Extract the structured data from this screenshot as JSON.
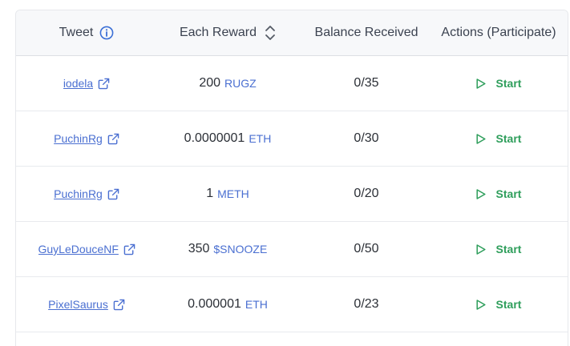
{
  "table": {
    "headers": {
      "tweet": "Tweet",
      "reward": "Each Reward",
      "balance": "Balance Received",
      "actions": "Actions (Participate)"
    },
    "rows": [
      {
        "tweet": "iodela",
        "amount": "200",
        "token": "RUGZ",
        "balance": "0/35",
        "action": "Start"
      },
      {
        "tweet": "PuchinRg",
        "amount": "0.0000001",
        "token": "ETH",
        "balance": "0/30",
        "action": "Start"
      },
      {
        "tweet": "PuchinRg",
        "amount": "1",
        "token": "METH",
        "balance": "0/20",
        "action": "Start"
      },
      {
        "tweet": "GuyLeDouceNF",
        "amount": "350",
        "token": "$SNOOZE",
        "balance": "0/50",
        "action": "Start"
      },
      {
        "tweet": "PixelSaurus",
        "amount": "0.000001",
        "token": "ETH",
        "balance": "0/23",
        "action": "Start"
      }
    ]
  },
  "colors": {
    "link": "#4a6fd1",
    "start": "#2e9e5b",
    "header_bg": "#f7f8fa"
  },
  "icons": {
    "info": "info-circle-icon",
    "sort": "sort-icon",
    "external": "external-link-icon",
    "play": "play-icon"
  }
}
